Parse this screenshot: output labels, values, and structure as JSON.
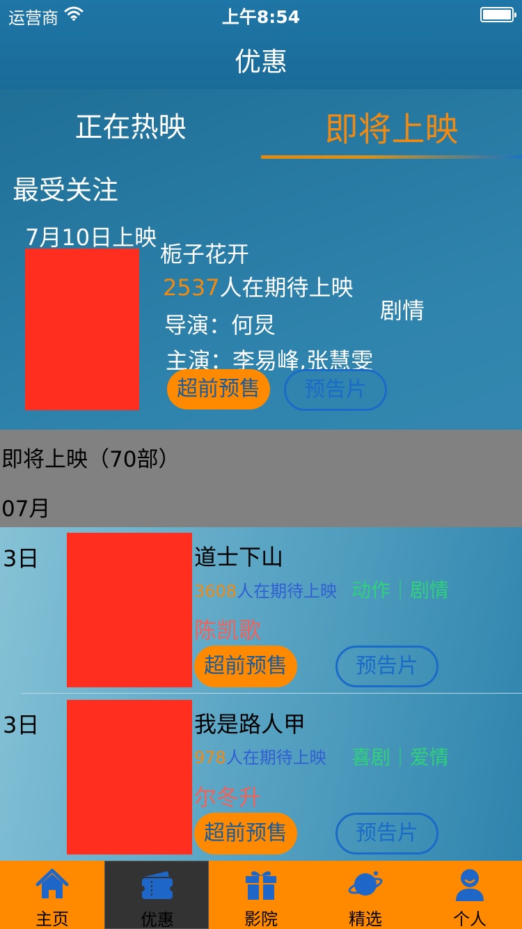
{
  "status_bar": {
    "carrier": "运营商",
    "time": "上午8:54"
  },
  "nav": {
    "title": "优惠"
  },
  "tabs": {
    "now_showing": "正在热映",
    "coming_soon": "即将上映"
  },
  "featured": {
    "section_title": "最受关注",
    "release_date": "7月10日上映",
    "name": "栀子花开",
    "expect_count": "2537",
    "expect_suffix": "人在期待上映",
    "genre": "剧情",
    "director": "导演：何炅",
    "cast": "主演：李易峰,张慧雯",
    "presale_label": "超前预售",
    "trailer_label": "预告片"
  },
  "upcoming": {
    "count_label": "即将上映（70部）",
    "month_label": "07月"
  },
  "movies": [
    {
      "day": "3日",
      "title": "道士下山",
      "expect_count": "3608",
      "expect_suffix": "人在期待上映",
      "genre": "动作｜剧情",
      "director": "陈凯歌",
      "presale_label": "超前预售",
      "trailer_label": "预告片"
    },
    {
      "day": "3日",
      "title": "我是路人甲",
      "expect_count": "978",
      "expect_suffix": "人在期待上映",
      "genre": "喜剧｜爱情",
      "director": "尔冬升",
      "presale_label": "超前预售",
      "trailer_label": "预告片"
    }
  ],
  "tabbar": [
    {
      "label": "主页",
      "icon": "home-icon"
    },
    {
      "label": "优惠",
      "icon": "ticket-icon"
    },
    {
      "label": "影院",
      "icon": "gift-icon"
    },
    {
      "label": "精选",
      "icon": "planet-icon"
    },
    {
      "label": "个人",
      "icon": "person-icon"
    }
  ],
  "colors": {
    "accent_orange": "#ff8a00",
    "tab_active_text": "#f08a12",
    "trailer_blue": "#1a6bc8",
    "poster_placeholder": "#ff2e1f",
    "genre_green": "#2fd27a",
    "director_red": "#f0625a"
  }
}
